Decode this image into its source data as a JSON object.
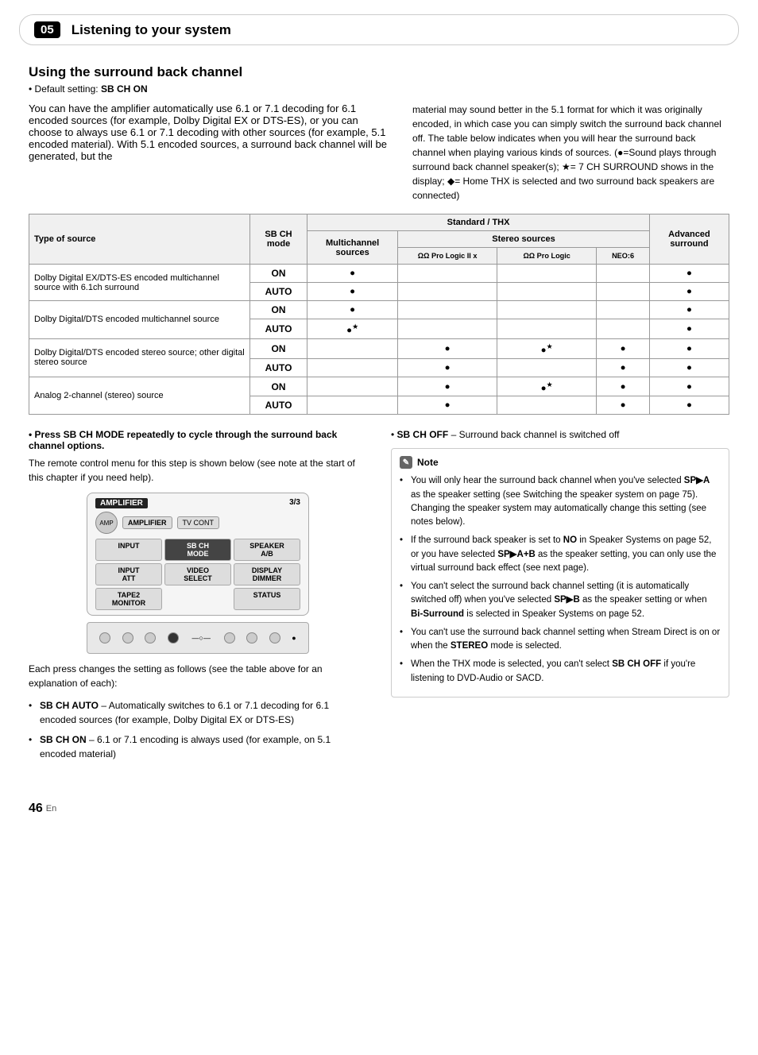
{
  "header": {
    "page_num": "05",
    "title": "Listening to your system"
  },
  "section": {
    "title": "Using the surround back channel",
    "subtitle_label": "Default setting:",
    "subtitle_value": "SB CH ON",
    "left_body": "You can have the amplifier automatically use 6.1 or 7.1 decoding for 6.1 encoded sources (for example, Dolby Digital EX or DTS-ES), or you can choose to always use 6.1 or 7.1 decoding with other sources (for example, 5.1 encoded material). With 5.1 encoded sources, a surround back channel will be generated, but the",
    "right_body": "material may sound better in the 5.1 format for which it was originally encoded, in which case you can simply switch the surround back channel off. The table below indicates when you will hear the surround back channel when playing various kinds of sources. (●=Sound plays through surround back channel speaker(s); ★= 7 CH SURROUND shows in the display; ◆= Home THX is selected and two surround back speakers are connected)"
  },
  "table": {
    "col_source": "Type of source",
    "col_sbch": "SB CH mode",
    "col_standard_thx": "Standard / THX",
    "col_multichannel": "Multichannel sources",
    "col_stereo_sources": "Stereo sources",
    "col_prologic2x": "ΩΩ Pro Logic II x",
    "col_prologic": "ΩΩ Pro Logic",
    "col_neo": "NEO:6",
    "col_advanced": "Advanced surround",
    "rows": [
      {
        "source": "Dolby Digital EX/DTS-ES encoded multichannel source with 6.1ch surround",
        "modes": [
          {
            "sbch": "ON",
            "multi": true,
            "pl2x": false,
            "pl": false,
            "neo": false,
            "adv": true
          },
          {
            "sbch": "AUTO",
            "multi": true,
            "pl2x": false,
            "pl": false,
            "neo": false,
            "adv": true
          }
        ]
      },
      {
        "source": "Dolby Digital/DTS encoded multichannel source",
        "modes": [
          {
            "sbch": "ON",
            "multi": true,
            "pl2x": false,
            "pl": false,
            "neo": false,
            "adv": true
          },
          {
            "sbch": "AUTO",
            "multi": "star",
            "pl2x": false,
            "pl": false,
            "neo": false,
            "adv": true
          }
        ]
      },
      {
        "source": "Dolby Digital/DTS encoded stereo source; other digital stereo source",
        "modes": [
          {
            "sbch": "ON",
            "multi": false,
            "pl2x": true,
            "pl": "star",
            "neo": true,
            "adv": true
          },
          {
            "sbch": "AUTO",
            "multi": false,
            "pl2x": true,
            "pl": false,
            "neo": true,
            "adv": true
          }
        ]
      },
      {
        "source": "Analog 2-channel (stereo) source",
        "modes": [
          {
            "sbch": "ON",
            "multi": false,
            "pl2x": true,
            "pl": "star",
            "neo": true,
            "adv": true
          },
          {
            "sbch": "AUTO",
            "multi": false,
            "pl2x": true,
            "pl": false,
            "neo": true,
            "adv": true
          }
        ]
      }
    ]
  },
  "instruction": {
    "press_title": "Press SB CH MODE repeatedly to cycle through the surround back channel options.",
    "press_body": "The remote control menu for this step is shown below (see note at the start of this chapter if you need help).",
    "remote_label": "AMPLIFIER",
    "remote_page": "3/3",
    "remote_button_sbch": "SB CH MODE",
    "remote_buttons": [
      "TV CONT",
      "INPUT",
      "SB CH MODE",
      "SPEAKER A/B",
      "INPUT ATT",
      "VIDEO SELECT",
      "DISPLAY DIMMER",
      "TAPE2 MONITOR",
      "STATUS"
    ]
  },
  "bottom_left": {
    "bullets": [
      {
        "text": "SB CH AUTO – Automatically switches to 6.1 or 7.1 decoding for 6.1 encoded sources (for example, Dolby Digital EX or DTS-ES)"
      },
      {
        "text": "SB CH ON – 6.1 or 7.1 encoding is always used (for example, on 5.1 encoded material)"
      }
    ]
  },
  "bottom_right": {
    "sbchoff_label": "SB CH OFF",
    "sbchoff_text": "– Surround back channel is switched off",
    "note_title": "Note",
    "note_items": [
      "You will only hear the surround back channel when you've selected SP▶A as the speaker setting (see Switching the speaker system on page 75). Changing the speaker system may automatically change this setting (see notes below).",
      "If the surround back speaker is set to NO in Speaker Systems on page 52, or you have selected SP▶A+B as the speaker setting, you can only use the virtual surround back effect (see next page).",
      "You can't select the surround back channel setting (it is automatically switched off) when you've selected SP▶B as the speaker setting or when Bi-Surround is selected in Speaker Systems on page 52.",
      "You can't use the surround back channel setting when Stream Direct is on or when the STEREO mode is selected.",
      "When the THX mode is selected, you can't select SB CH OFF if you're listening to DVD-Audio or SACD."
    ]
  },
  "page_number": "46",
  "page_en": "En"
}
